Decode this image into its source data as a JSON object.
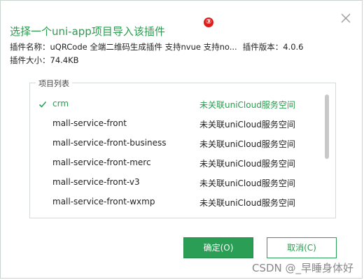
{
  "dialog": {
    "title": "选择一个uni-app项目导入该插件",
    "step_marker": "③",
    "close_icon": "close-icon",
    "plugin_name_label": "插件名称：",
    "plugin_name": "uQRCode 全端二维码生成插件 支持nvue 支持no...",
    "plugin_version_label": "插件版本：",
    "plugin_version": "4.0.6",
    "plugin_size_label": "插件大小：",
    "plugin_size": "74.4KB"
  },
  "project_list": {
    "legend": "项目列表",
    "items": [
      {
        "name": "crm",
        "status": "未关联uniCloud服务空间",
        "selected": true
      },
      {
        "name": "mall-service-front",
        "status": "未关联uniCloud服务空间",
        "selected": false
      },
      {
        "name": "mall-service-front-business",
        "status": "未关联uniCloud服务空间",
        "selected": false
      },
      {
        "name": "mall-service-front-merc",
        "status": "未关联uniCloud服务空间",
        "selected": false
      },
      {
        "name": "mall-service-front-v3",
        "status": "未关联uniCloud服务空间",
        "selected": false
      },
      {
        "name": "mall-service-front-wxmp",
        "status": "未关联uniCloud服务空间",
        "selected": false
      }
    ]
  },
  "buttons": {
    "ok_label": "确定(O)",
    "cancel_label": "取消(C)"
  },
  "watermark": "CSDN @_早睡身体好",
  "colors": {
    "accent": "#2b9e55",
    "step_marker": "#e01b1b"
  }
}
